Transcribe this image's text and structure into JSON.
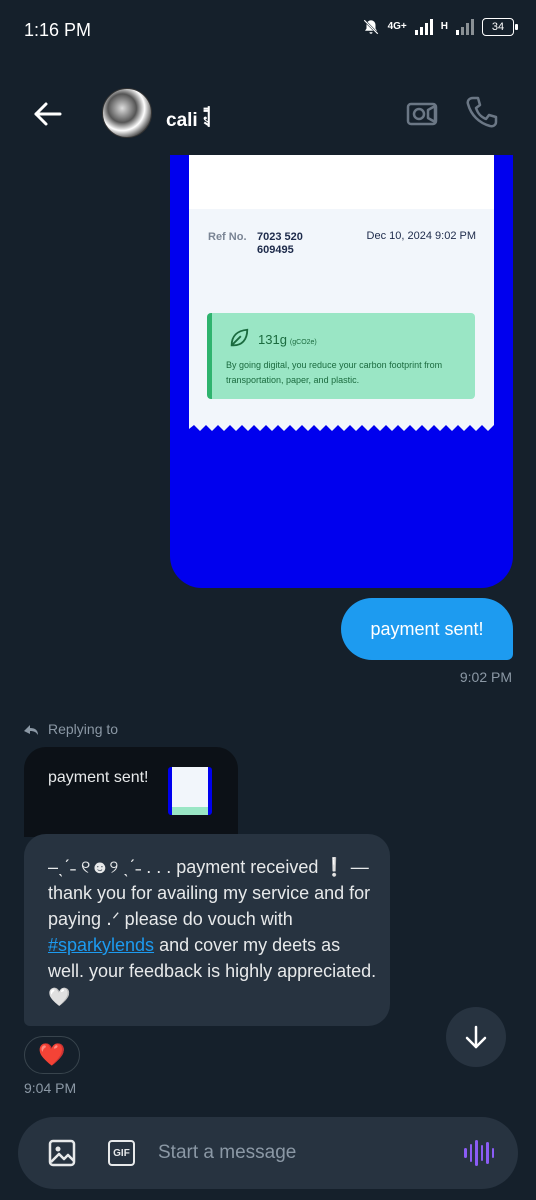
{
  "status_bar": {
    "time": "1:16 PM",
    "network_primary": "4G+",
    "network_secondary": "H",
    "battery": "34"
  },
  "header": {
    "contact_name": "cali 𓌟"
  },
  "receipt": {
    "ref_label": "Ref No.",
    "ref_number": "7023 520 609495",
    "date": "Dec 10, 2024 9:02 PM",
    "eco_amount": "131g",
    "eco_unit": "(gCO2e)",
    "eco_text": "By going digital, you reduce your carbon footprint from transportation, paper, and plastic."
  },
  "sent_message": {
    "text": "payment sent!",
    "time": "9:02 PM"
  },
  "reply": {
    "label": "Replying to",
    "quoted_text": "payment sent!"
  },
  "received_message": {
    "text_before": "‒ˎˊ˗ ୧☻୨ ˎˊ˗  . . . payment received ❕ — thank you for availing my service and for paying ․ᐟ please do vouch with ",
    "hashtag": "#sparkylends",
    "text_after": " and cover my deets as well. your feedback is highly appreciated. 🤍",
    "reaction": "❤️",
    "time": "9:04 PM"
  },
  "composer": {
    "gif_label": "GIF",
    "placeholder": "Start a message"
  }
}
